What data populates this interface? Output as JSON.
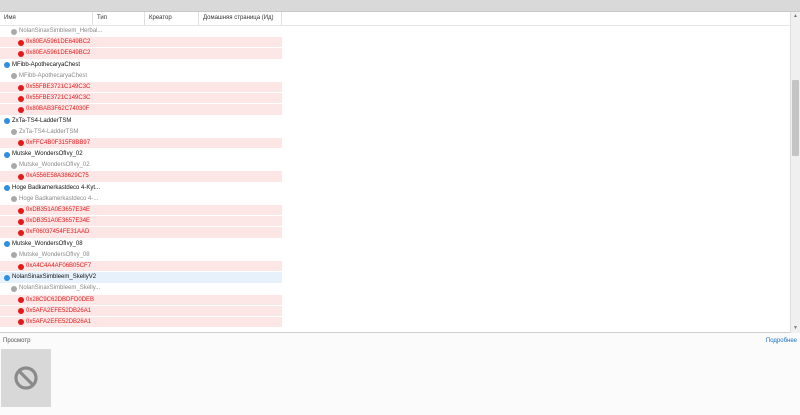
{
  "columns": [
    "Имя",
    "Тип",
    "Креатор",
    "Домашняя страница (Ид)"
  ],
  "rows": [
    {
      "kind": "grey",
      "label": "NolanSinaxSimbleem_Herbal..."
    },
    {
      "kind": "pink",
      "label": "0x80EA5961DE649BC2"
    },
    {
      "kind": "pink",
      "label": "0x80EA5961DE649BC2"
    },
    {
      "kind": "group",
      "label": "MFibb-ApothecaryaChest"
    },
    {
      "kind": "grey",
      "label": "MFibb-ApothecaryaChest"
    },
    {
      "kind": "pink",
      "label": "0x55FBE3721C149C3C"
    },
    {
      "kind": "pink",
      "label": "0x55FBE3721C149C3C"
    },
    {
      "kind": "pink",
      "label": "0x80BAB3F62C74030F"
    },
    {
      "kind": "group",
      "label": "ZxTa-TS4-LadderTSM"
    },
    {
      "kind": "grey",
      "label": "ZxTa-TS4-LadderTSM"
    },
    {
      "kind": "pink",
      "label": "0xFFC4B0F315F8BB97"
    },
    {
      "kind": "group",
      "label": "Mutske_WondersOfIvy_02"
    },
    {
      "kind": "grey",
      "label": "Mutske_WondersOfIvy_02"
    },
    {
      "kind": "pink",
      "label": "0xA556E58A38629C75"
    },
    {
      "kind": "group",
      "label": "Hoge Badkamerkastdeco 4-Kyt..."
    },
    {
      "kind": "grey",
      "label": "Hoge Badkamerkastdeco 4-..."
    },
    {
      "kind": "pink",
      "label": "0xDB351A0E3657E34E"
    },
    {
      "kind": "pink",
      "label": "0xDB351A0E3657E34E"
    },
    {
      "kind": "pink",
      "label": "0xF06037454FE31AAD"
    },
    {
      "kind": "group",
      "label": "Mutske_WondersOfIvy_08"
    },
    {
      "kind": "grey",
      "label": "Mutske_WondersOfIvy_08"
    },
    {
      "kind": "pink",
      "label": "0xA4C4A4AF06B05CF7"
    },
    {
      "kind": "group-selected",
      "label": "NolanSinaxSimbleem_SkellyV2"
    },
    {
      "kind": "grey",
      "label": "NolanSinaxSimbleem_Skelly..."
    },
    {
      "kind": "pink",
      "label": "0x28C9C62DBDFD0DEB"
    },
    {
      "kind": "pink",
      "label": "0x5AFA2EFE52DB26A1"
    },
    {
      "kind": "pink",
      "label": "0x5AFA2EFE52DB26A1"
    }
  ],
  "footer": {
    "preview_label": "Просмотр",
    "details_link": "Подробнее"
  },
  "preview_icon": "no-image-icon"
}
